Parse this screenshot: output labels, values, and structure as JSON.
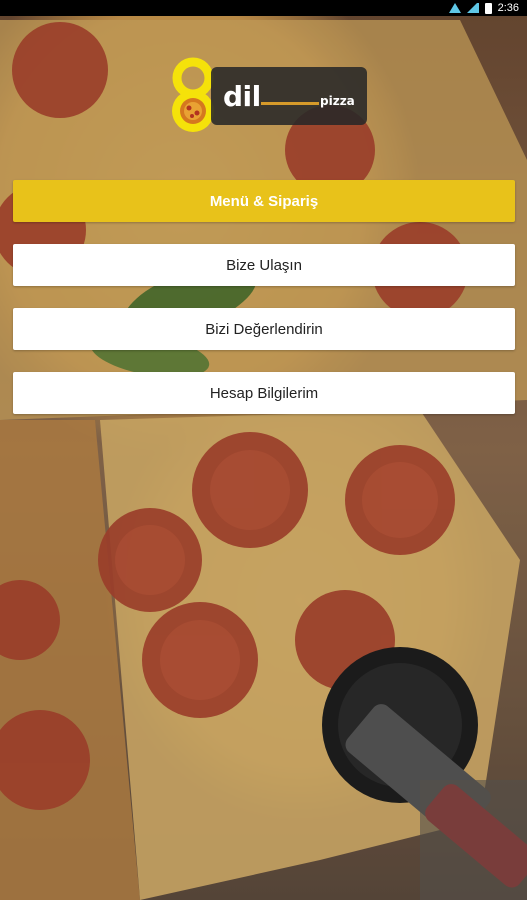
{
  "status_bar": {
    "time": "2:36",
    "icons": [
      "wifi-icon",
      "signal-icon",
      "battery-icon"
    ]
  },
  "logo": {
    "numeral": "8",
    "word": "dil",
    "suffix": "pizza",
    "accent_color": "#f5e20a"
  },
  "menu": {
    "items": [
      {
        "label": "Menü & Sipariş",
        "style": "primary"
      },
      {
        "label": "Bize Ulaşın",
        "style": "default"
      },
      {
        "label": "Bizi Değerlendirin",
        "style": "default"
      },
      {
        "label": "Hesap Bilgilerim",
        "style": "default"
      }
    ]
  },
  "colors": {
    "primary_button": "#e8c21a",
    "button": "#ffffff",
    "logo_yellow": "#f5e20a"
  }
}
